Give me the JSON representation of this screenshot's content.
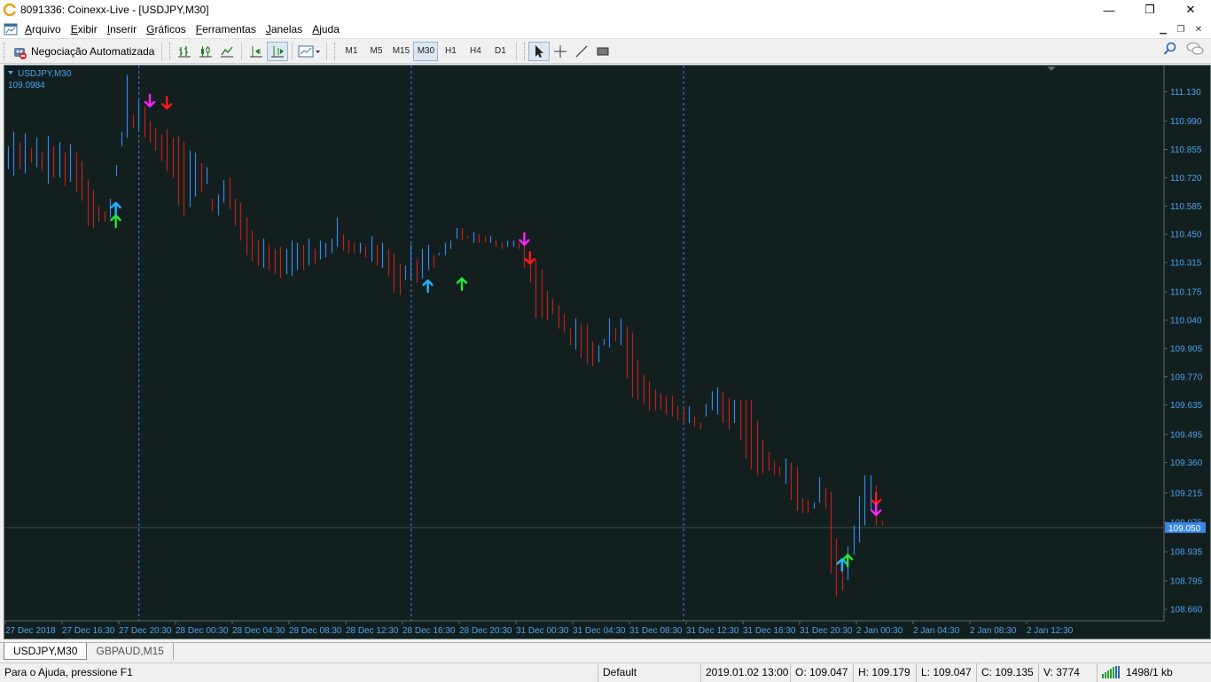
{
  "window": {
    "title": "8091336: Coinexx-Live - [USDJPY,M30]",
    "minimize": "—",
    "maximize": "❐",
    "close": "✕"
  },
  "menu": {
    "items": [
      "Arquivo",
      "Exibir",
      "Inserir",
      "Gráficos",
      "Ferramentas",
      "Janelas",
      "Ajuda"
    ],
    "underline": [
      "A",
      "E",
      "I",
      "G",
      "F",
      "J",
      "A"
    ]
  },
  "toolbar": {
    "auto_trading": "Negociação Automatizada",
    "timeframes": [
      "M1",
      "M5",
      "M15",
      "M30",
      "H1",
      "H4",
      "D1"
    ],
    "active_timeframe": "M30"
  },
  "chart": {
    "symbol_label": "USDJPY,M30",
    "price_label": "109.0984",
    "current_price": "109.050",
    "colors": {
      "background": "#131f1f",
      "bull": "#3a86e6",
      "bear": "#c0201a",
      "axis_text": "#4aa3f0",
      "buy_arrow_1": "#1fb3ff",
      "buy_arrow_2": "#22e83a",
      "sell_arrow_1": "#ff22ff",
      "sell_arrow_2": "#ff1a1a"
    }
  },
  "chart_data": {
    "type": "bar",
    "symbol": "USDJPY",
    "timeframe": "M30",
    "ylim": [
      108.66,
      111.2
    ],
    "y_ticks": [
      "111.130",
      "110.990",
      "110.855",
      "110.720",
      "110.585",
      "110.450",
      "110.315",
      "110.175",
      "110.040",
      "109.905",
      "109.770",
      "109.635",
      "109.495",
      "109.360",
      "109.215",
      "109.075",
      "108.935",
      "108.795",
      "108.660"
    ],
    "x_ticks": [
      "27 Dec 2018",
      "27 Dec 16:30",
      "27 Dec 20:30",
      "28 Dec 00:30",
      "28 Dec 04:30",
      "28 Dec 08:30",
      "28 Dec 12:30",
      "28 Dec 16:30",
      "28 Dec 20:30",
      "31 Dec 00:30",
      "31 Dec 04:30",
      "31 Dec 08:30",
      "31 Dec 12:30",
      "31 Dec 16:30",
      "31 Dec 20:30",
      "2 Jan 00:30",
      "2 Jan 04:30",
      "2 Jan 08:30",
      "2 Jan 12:30"
    ],
    "bars_high": [
      110.87,
      110.94,
      110.89,
      110.93,
      110.86,
      110.91,
      110.84,
      110.92,
      110.87,
      110.89,
      110.84,
      110.88,
      110.84,
      110.8,
      110.71,
      110.66,
      110.59,
      110.51,
      110.53,
      110.78,
      110.94,
      111.21,
      111.02,
      111.09,
      111.06,
      110.99,
      110.96,
      110.93,
      110.95,
      110.91,
      110.92,
      110.89,
      110.85,
      110.84,
      110.79,
      110.77,
      110.62,
      110.64,
      110.71,
      110.72,
      110.62,
      110.6,
      110.53,
      110.47,
      110.42,
      110.43,
      110.4,
      110.38,
      110.39,
      110.38,
      110.42,
      110.41,
      110.4,
      110.43,
      110.38,
      110.42,
      110.41,
      110.43,
      110.53,
      110.45,
      110.42,
      110.41,
      110.41,
      110.39,
      110.44,
      110.4,
      110.41,
      110.38,
      110.36,
      110.31,
      110.3,
      110.4,
      110.33,
      110.38,
      110.4,
      110.35,
      110.36,
      110.41,
      110.42,
      110.48,
      110.48,
      110.44,
      110.46,
      110.45,
      110.44,
      110.44,
      110.42,
      110.41,
      110.42,
      110.42,
      110.41,
      110.42,
      110.36,
      110.33,
      110.28,
      110.18,
      110.14,
      110.11,
      110.07,
      110.0,
      110.05,
      110.02,
      110.02,
      109.94,
      109.92,
      109.95,
      110.05,
      110.0,
      110.05,
      110.01,
      109.98,
      109.85,
      109.78,
      109.75,
      109.71,
      109.69,
      109.68,
      109.68,
      109.63,
      109.62,
      109.63,
      109.58,
      109.55,
      109.64,
      109.7,
      109.72,
      109.7,
      109.67,
      109.66,
      109.66,
      109.66,
      109.66,
      109.56,
      109.47,
      109.41,
      109.37,
      109.34,
      109.38,
      109.36,
      109.34,
      109.19,
      109.18,
      109.17,
      109.29,
      109.24,
      109.22,
      109.0,
      108.85,
      108.96,
      109.06,
      109.2,
      109.3,
      109.3,
      109.25,
      109.06
    ],
    "bars_low": [
      110.76,
      110.73,
      110.76,
      110.74,
      110.79,
      110.77,
      110.75,
      110.69,
      110.72,
      110.72,
      110.68,
      110.7,
      110.65,
      110.61,
      110.49,
      110.48,
      110.51,
      110.56,
      110.62,
      110.73,
      110.87,
      110.91,
      110.96,
      110.95,
      110.91,
      110.89,
      110.85,
      110.8,
      110.75,
      110.72,
      110.59,
      110.54,
      110.58,
      110.63,
      110.65,
      110.69,
      110.56,
      110.54,
      110.6,
      110.57,
      110.49,
      110.42,
      110.35,
      110.32,
      110.3,
      110.29,
      110.28,
      110.26,
      110.24,
      110.26,
      110.25,
      110.28,
      110.28,
      110.3,
      110.31,
      110.33,
      110.34,
      110.36,
      110.39,
      110.37,
      110.36,
      110.36,
      110.36,
      110.34,
      110.32,
      110.3,
      110.29,
      110.25,
      110.17,
      110.16,
      110.23,
      110.23,
      110.22,
      110.24,
      110.28,
      110.29,
      110.35,
      110.35,
      110.38,
      110.43,
      110.42,
      110.43,
      110.41,
      110.41,
      110.41,
      110.41,
      110.39,
      110.38,
      110.39,
      110.39,
      110.38,
      110.29,
      110.22,
      110.05,
      110.05,
      110.04,
      110.07,
      110.0,
      109.98,
      109.92,
      109.9,
      109.86,
      109.83,
      109.82,
      109.84,
      109.92,
      109.91,
      109.94,
      109.92,
      109.76,
      109.67,
      109.66,
      109.64,
      109.61,
      109.61,
      109.61,
      109.59,
      109.58,
      109.56,
      109.55,
      109.55,
      109.53,
      109.52,
      109.58,
      109.61,
      109.59,
      109.55,
      109.52,
      109.55,
      109.47,
      109.38,
      109.33,
      109.3,
      109.31,
      109.32,
      109.3,
      109.3,
      109.26,
      109.18,
      109.13,
      109.12,
      109.12,
      109.14,
      109.17,
      109.14,
      108.83,
      108.72,
      108.75,
      108.8,
      108.92,
      108.98,
      109.06,
      109.13,
      109.06,
      109.08,
      108.82,
      108.92
    ],
    "series": [
      {
        "name": "up-arrows",
        "points": [
          {
            "bar": 19,
            "price": 110.57
          },
          {
            "bar": 19,
            "price": 110.51
          },
          {
            "bar": 74,
            "price": 110.2
          },
          {
            "bar": 80,
            "price": 110.21
          },
          {
            "bar": 147,
            "price": 108.87
          },
          {
            "bar": 148,
            "price": 108.89
          }
        ]
      },
      {
        "name": "down-arrows",
        "points": [
          {
            "bar": 25,
            "price": 111.09
          },
          {
            "bar": 28,
            "price": 111.08
          },
          {
            "bar": 91,
            "price": 110.43
          },
          {
            "bar": 92,
            "price": 110.34
          },
          {
            "bar": 153,
            "price": 109.19
          },
          {
            "bar": 153,
            "price": 109.14
          }
        ]
      }
    ],
    "period_separators": [
      23,
      71,
      119
    ]
  },
  "tabs": [
    "USDJPY,M30",
    "GBPAUD,M15"
  ],
  "status": {
    "help": "Para o Ajuda, pressione F1",
    "profile": "Default",
    "datetime": "2019.01.02 13:00",
    "open": "O: 109.047",
    "high": "H: 109.179",
    "low": "L: 109.047",
    "close": "C: 109.135",
    "volume": "V: 3774",
    "traffic": "1498/1 kb"
  }
}
